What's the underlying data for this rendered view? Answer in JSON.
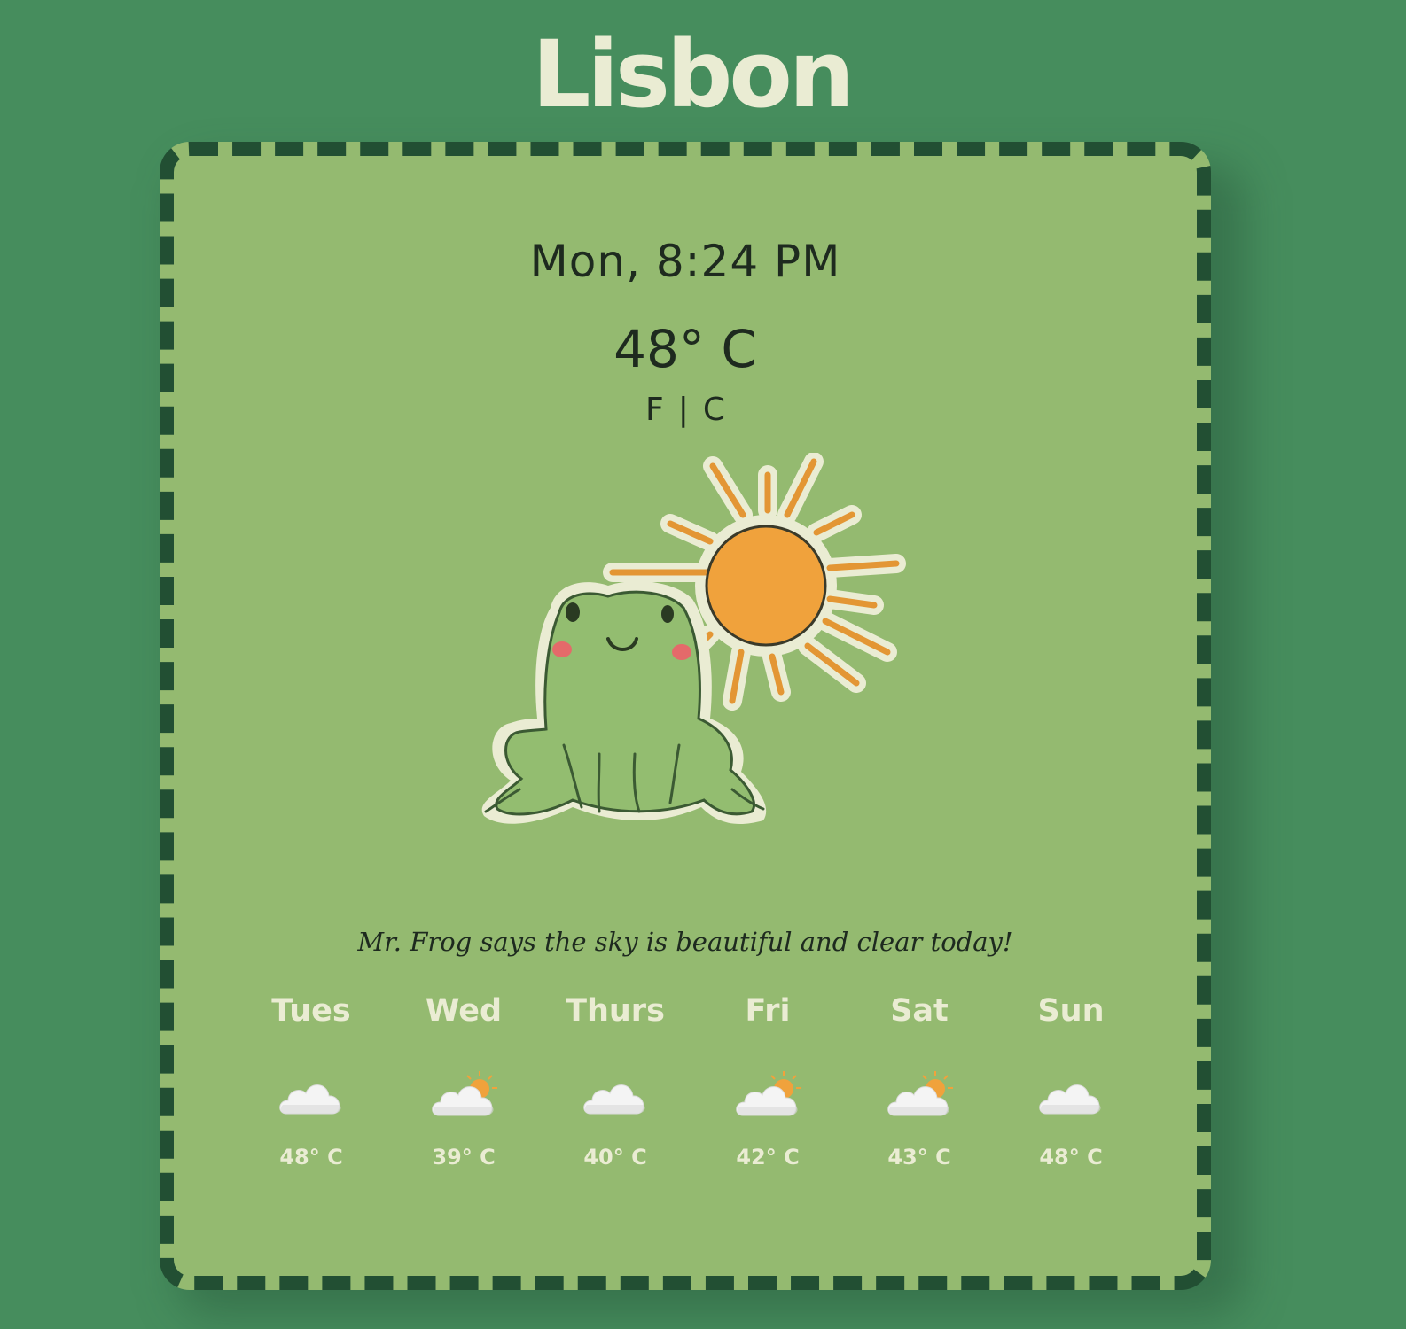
{
  "city": "Lisbon",
  "datetime": "Mon, 8:24 PM",
  "current_temp": "48° C",
  "units": {
    "fahrenheit_label": "F",
    "separator": "|",
    "celsius_label": "C"
  },
  "illustration": {
    "icon": "frog-with-sun-illustration"
  },
  "message": "Mr. Frog says the sky is beautiful and clear today!",
  "forecast": [
    {
      "day": "Tues",
      "icon": "cloud-icon",
      "temp": "48° C"
    },
    {
      "day": "Wed",
      "icon": "partly-sunny-icon",
      "temp": "39° C"
    },
    {
      "day": "Thurs",
      "icon": "cloud-icon",
      "temp": "40° C"
    },
    {
      "day": "Fri",
      "icon": "partly-sunny-icon",
      "temp": "42° C"
    },
    {
      "day": "Sat",
      "icon": "partly-sunny-icon",
      "temp": "43° C"
    },
    {
      "day": "Sun",
      "icon": "cloud-icon",
      "temp": "48° C"
    }
  ],
  "colors": {
    "background": "#468d5d",
    "card": "#94ba70",
    "card_border": "#224f33",
    "title_text": "#eaecd3",
    "sun": "#f0a23c",
    "frog": "#93bd70"
  }
}
